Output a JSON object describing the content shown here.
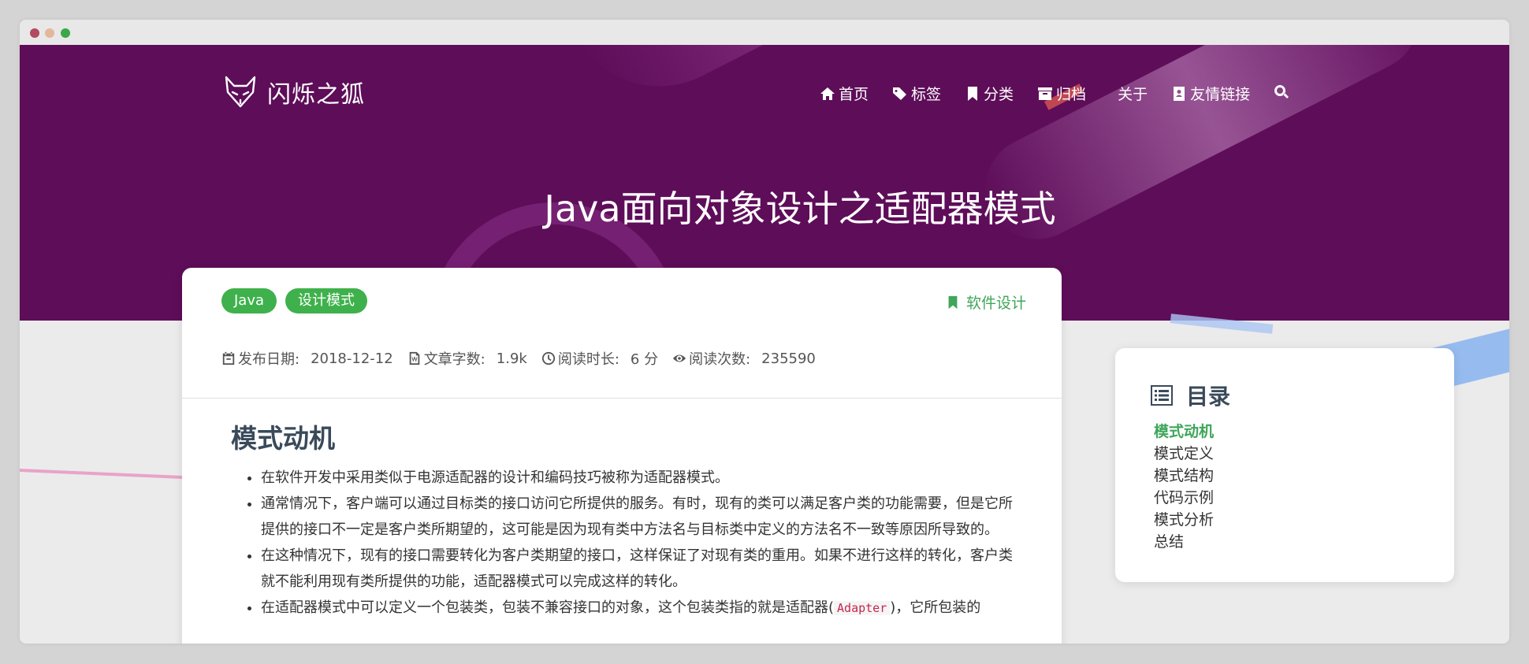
{
  "brand": {
    "name": "闪烁之狐"
  },
  "nav": {
    "items": [
      {
        "label": "首页",
        "icon": "home-icon"
      },
      {
        "label": "标签",
        "icon": "tags-icon"
      },
      {
        "label": "分类",
        "icon": "bookmark-icon"
      },
      {
        "label": "归档",
        "icon": "archive-icon"
      },
      {
        "label": "关于",
        "icon": ""
      },
      {
        "label": "友情链接",
        "icon": "address-book-icon"
      }
    ],
    "search_icon": "search-icon"
  },
  "hero": {
    "title": "Java面向对象设计之适配器模式"
  },
  "post": {
    "tags": [
      "Java",
      "设计模式"
    ],
    "category": "软件设计",
    "meta": {
      "date_label": "发布日期:",
      "date_value": "2018-12-12",
      "words_label": "文章字数:",
      "words_value": "1.9k",
      "time_label": "阅读时长:",
      "time_value": "6 分",
      "views_label": "阅读次数:",
      "views_value": "235590"
    },
    "section_title": "模式动机",
    "bullets": [
      "在软件开发中采用类似于电源适配器的设计和编码技巧被称为适配器模式。",
      "通常情况下，客户端可以通过目标类的接口访问它所提供的服务。有时，现有的类可以满足客户类的功能需要，但是它所提供的接口不一定是客户类所期望的，这可能是因为现有类中方法名与目标类中定义的方法名不一致等原因所导致的。",
      "在这种情况下，现有的接口需要转化为客户类期望的接口，这样保证了对现有类的重用。如果不进行这样的转化，客户类就不能利用现有类所提供的功能，适配器模式可以完成这样的转化。"
    ],
    "bullet4_pre": "在适配器模式中可以定义一个包装类，包装不兼容接口的对象，这个包装类指的就是适配器(",
    "bullet4_code": "Adapter",
    "bullet4_post": ")，它所包装的"
  },
  "toc": {
    "title": "目录",
    "items": [
      "模式动机",
      "模式定义",
      "模式结构",
      "代码示例",
      "模式分析",
      "总结"
    ],
    "active_index": 0
  },
  "colors": {
    "hero_bg": "#5e0d59",
    "accent_green": "#3fb14c",
    "toc_active": "#3fa65a"
  }
}
